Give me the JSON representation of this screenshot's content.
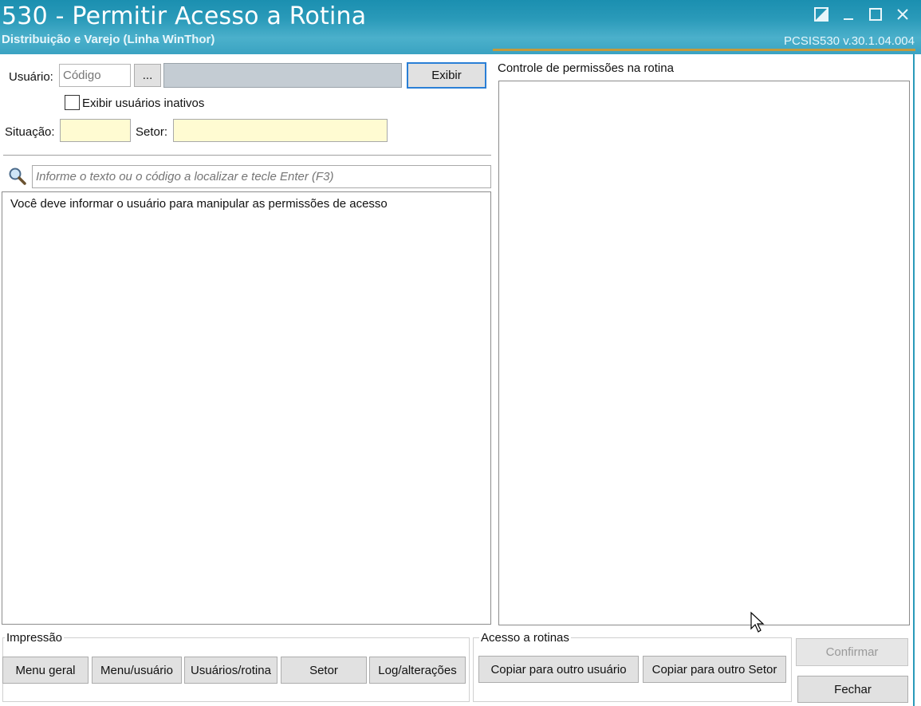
{
  "window": {
    "title": "530 - Permitir Acesso a Rotina",
    "subtitle": "Distribuição e Varejo (Linha WinThor)",
    "version": "PCSIS530  v.30.1.04.004"
  },
  "user_section": {
    "usuario_label": "Usuário:",
    "codigo_placeholder": "Código",
    "browse_label": "...",
    "user_name_value": "",
    "exibir_label": "Exibir",
    "inactive_checkbox_label": "Exibir usuários inativos",
    "inactive_checked": false,
    "situacao_label": "Situação:",
    "situacao_value": "",
    "setor_label": "Setor:",
    "setor_value": ""
  },
  "search": {
    "icon": "search-icon",
    "placeholder": "Informe o texto ou o código a localizar e tecle Enter (F3)"
  },
  "routine_list": {
    "message": "Você deve informar o usuário para manipular as permissões de acesso"
  },
  "permissions": {
    "title": "Controle de permissões na rotina"
  },
  "impressao": {
    "label": "Impressão",
    "buttons": [
      "Menu geral",
      "Menu/usuário",
      "Usuários/rotina",
      "Setor",
      "Log/alterações"
    ]
  },
  "acesso": {
    "label": "Acesso a rotinas",
    "buttons": [
      "Copiar para outro usuário",
      "Copiar para outro Setor"
    ]
  },
  "actions": {
    "confirmar": "Confirmar",
    "fechar": "Fechar"
  },
  "colors": {
    "titlebar": "#2a9ab9",
    "accent_line": "#c49a3c",
    "input_yellow": "#fffbd2",
    "focus_border": "#2a7fd6"
  }
}
